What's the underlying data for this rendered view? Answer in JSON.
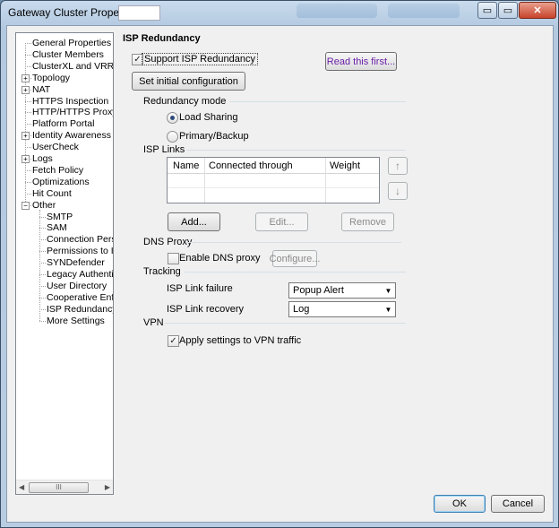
{
  "window": {
    "title": "Gateway Cluster Properties -",
    "minimize_glyph": "▭",
    "restore_glyph": "▭",
    "close_glyph": "✕"
  },
  "tree": {
    "items": [
      {
        "label": "General Properties",
        "level": 0
      },
      {
        "label": "Cluster Members",
        "level": 0
      },
      {
        "label": "ClusterXL and VRRP",
        "level": 0
      },
      {
        "label": "Topology",
        "level": 0,
        "expander": "+"
      },
      {
        "label": "NAT",
        "level": 0,
        "expander": "+"
      },
      {
        "label": "HTTPS Inspection",
        "level": 0
      },
      {
        "label": "HTTP/HTTPS Proxy",
        "level": 0
      },
      {
        "label": "Platform Portal",
        "level": 0
      },
      {
        "label": "Identity Awareness",
        "level": 0,
        "expander": "+"
      },
      {
        "label": "UserCheck",
        "level": 0
      },
      {
        "label": "Logs",
        "level": 0,
        "expander": "+"
      },
      {
        "label": "Fetch Policy",
        "level": 0
      },
      {
        "label": "Optimizations",
        "level": 0
      },
      {
        "label": "Hit Count",
        "level": 0
      },
      {
        "label": "Other",
        "level": 0,
        "expander": "−"
      },
      {
        "label": "SMTP",
        "level": 1
      },
      {
        "label": "SAM",
        "level": 1
      },
      {
        "label": "Connection Persist",
        "level": 1
      },
      {
        "label": "Permissions to Inst-",
        "level": 1
      },
      {
        "label": "SYNDefender",
        "level": 1
      },
      {
        "label": "Legacy Authentica",
        "level": 1
      },
      {
        "label": "User Directory",
        "level": 1
      },
      {
        "label": "Cooperative Enforc",
        "level": 1
      },
      {
        "label": "ISP Redundancy",
        "level": 1
      },
      {
        "label": "More Settings",
        "level": 1
      }
    ],
    "scroll_thumb": "III"
  },
  "panel": {
    "title": "ISP Redundancy",
    "support_isp_label": "Support ISP Redundancy",
    "support_isp_checked": true,
    "read_first_label": "Read this first...",
    "set_initial_config_label": "Set initial configuration",
    "redundancy_mode_label": "Redundancy mode",
    "load_sharing_label": "Load Sharing",
    "primary_backup_label": "Primary/Backup",
    "selected_mode": "Load Sharing",
    "isp_links_label": "ISP Links",
    "columns": [
      "Name",
      "Connected through",
      "Weight"
    ],
    "rows": [],
    "move_up_glyph": "↑",
    "move_down_glyph": "↓",
    "add_label": "Add...",
    "edit_label": "Edit...",
    "remove_label": "Remove",
    "dns_proxy_label": "DNS Proxy",
    "enable_dns_label": "Enable DNS proxy",
    "enable_dns_checked": false,
    "configure_label": "Configure...",
    "tracking_label": "Tracking",
    "isp_failure_label": "ISP Link failure",
    "isp_failure_value": "Popup Alert",
    "isp_recovery_label": "ISP Link recovery",
    "isp_recovery_value": "Log",
    "vpn_label": "VPN",
    "vpn_apply_label": "Apply settings to VPN traffic",
    "vpn_apply_checked": true
  },
  "footer": {
    "ok_label": "OK",
    "cancel_label": "Cancel"
  }
}
